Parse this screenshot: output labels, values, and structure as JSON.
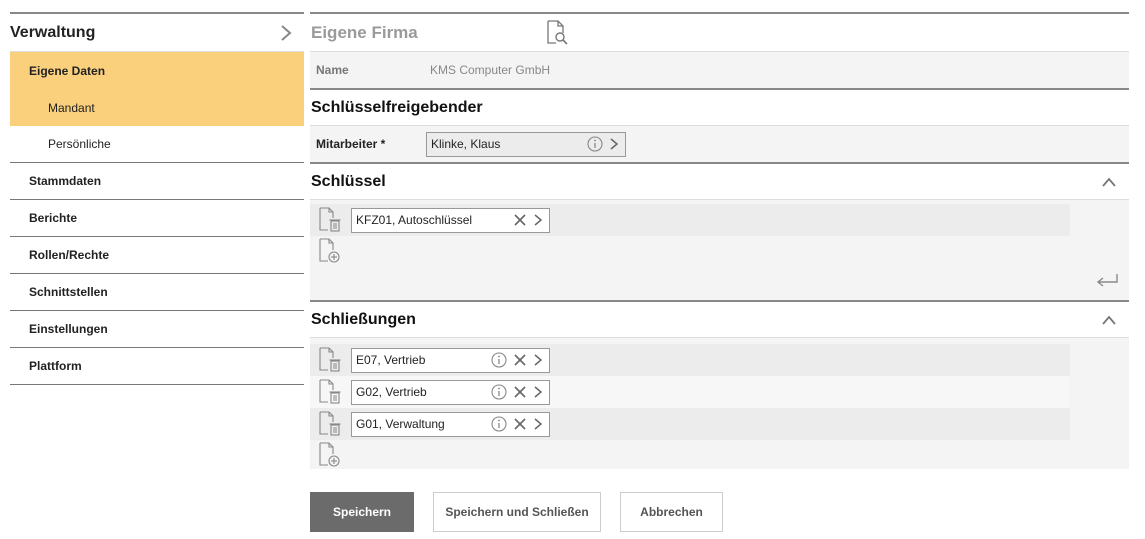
{
  "sidebar": {
    "title": "Verwaltung",
    "items": [
      {
        "label": "Eigene Daten"
      },
      {
        "label": "Mandant"
      },
      {
        "label": "Persönliche"
      },
      {
        "label": "Stammdaten"
      },
      {
        "label": "Berichte"
      },
      {
        "label": "Rollen/Rechte"
      },
      {
        "label": "Schnittstellen"
      },
      {
        "label": "Einstellungen"
      },
      {
        "label": "Plattform"
      }
    ]
  },
  "header": {
    "title": "Eigene Firma"
  },
  "company": {
    "name_label": "Name",
    "name_value": "KMS Computer GmbH"
  },
  "key_approver": {
    "title": "Schlüsselfreigebender",
    "employee_label": "Mitarbeiter *",
    "employee_value": "Klinke, Klaus"
  },
  "keys": {
    "title": "Schlüssel",
    "items": [
      {
        "label": "KFZ01, Autoschlüssel"
      }
    ]
  },
  "locks": {
    "title": "Schließungen",
    "items": [
      {
        "label": "E07, Vertrieb"
      },
      {
        "label": "G02, Vertrieb"
      },
      {
        "label": "G01, Verwaltung"
      }
    ]
  },
  "buttons": {
    "save": "Speichern",
    "save_close": "Speichern und Schließen",
    "cancel": "Abbrechen"
  },
  "colors": {
    "active_nav": "#fbd07d",
    "primary_button": "#6b6b6b"
  }
}
